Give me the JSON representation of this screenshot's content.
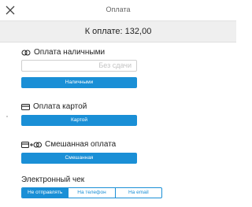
{
  "window": {
    "title": "Оплата"
  },
  "header": {
    "amount": "К оплате: 132,00"
  },
  "cash": {
    "title": "Оплата наличными",
    "input_placeholder": "Без сдачи",
    "button": "Наличными"
  },
  "card": {
    "title": "Оплата картой",
    "button": "Картой"
  },
  "mixed": {
    "title": "Смешанная оплата",
    "button": "Смешанная"
  },
  "receipt": {
    "title": "Электронный чек",
    "options": [
      "Не отправлять",
      "На телефон",
      "На email"
    ],
    "selected": "Не отправлять"
  },
  "colors": {
    "accent": "#1a8fd6",
    "amount_bar": "#efefef"
  }
}
